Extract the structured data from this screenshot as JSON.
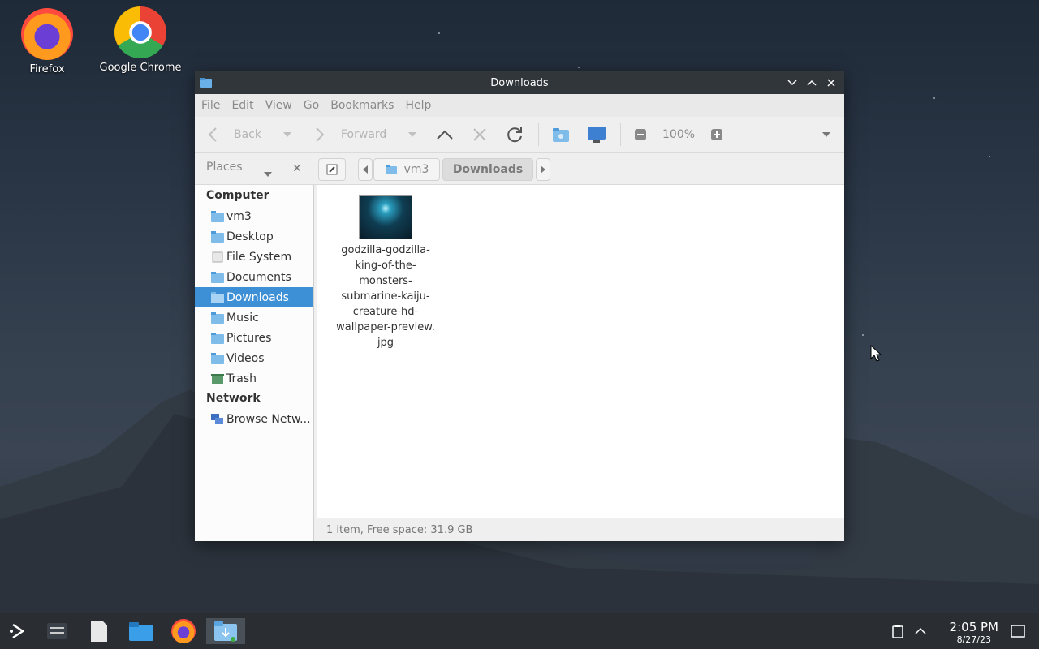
{
  "desktop": {
    "icons": [
      {
        "label": "Firefox"
      },
      {
        "label": "Google Chrome"
      }
    ]
  },
  "window": {
    "title": "Downloads",
    "menu": [
      "File",
      "Edit",
      "View",
      "Go",
      "Bookmarks",
      "Help"
    ],
    "toolbar": {
      "back_label": "Back",
      "forward_label": "Forward",
      "zoom": "100%"
    },
    "locbar": {
      "places_label": "Places",
      "crumbs": [
        "vm3",
        "Downloads"
      ]
    },
    "sidebar": {
      "computer_heading": "Computer",
      "network_heading": "Network",
      "items": [
        {
          "label": "vm3"
        },
        {
          "label": "Desktop"
        },
        {
          "label": "File System"
        },
        {
          "label": "Documents"
        },
        {
          "label": "Downloads",
          "selected": true
        },
        {
          "label": "Music"
        },
        {
          "label": "Pictures"
        },
        {
          "label": "Videos"
        },
        {
          "label": "Trash"
        }
      ],
      "network_items": [
        {
          "label": "Browse Netw..."
        }
      ]
    },
    "files": [
      {
        "name": "godzilla-godzilla-king-of-the-monsters-submarine-kaiju-creature-hd-wallpaper-preview.jpg",
        "lines": [
          "godzilla-godzilla-",
          "king-of-the-",
          "monsters-",
          "submarine-kaiju-",
          "creature-hd-",
          "wallpaper-preview.",
          "jpg"
        ]
      }
    ],
    "status": "1 item, Free space: 31.9 GB"
  },
  "taskbar": {
    "time": "2:05 PM",
    "date": "8/27/23"
  },
  "colors": {
    "selection": "#3d8fd6",
    "titlebar": "#31363b",
    "taskbar": "#2a2e32"
  }
}
